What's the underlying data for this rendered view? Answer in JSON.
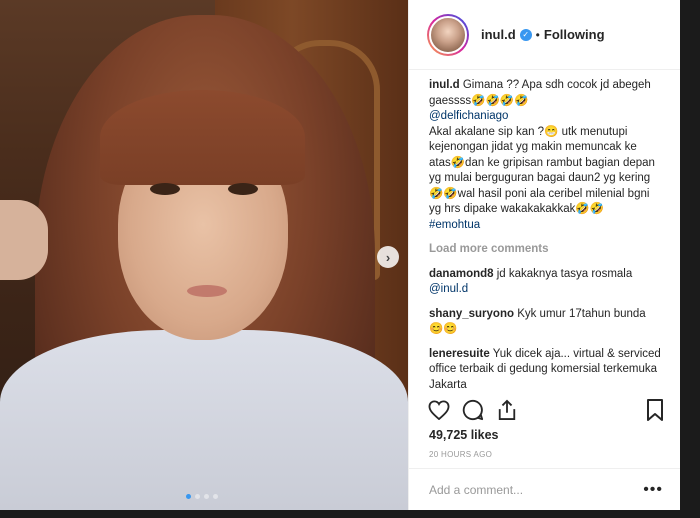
{
  "post": {
    "username": "inul.d",
    "separator": "•",
    "follow_status": "Following",
    "caption_username": "inul.d",
    "caption_line1": " Gimana ?? Apa sdh cocok jd abegeh gaessss🤣🤣🤣🤣",
    "mention": "@delfichaniago",
    "caption_body": "Akal akalane sip kan ?😁 utk menutupi kejenongan jidat yg makin memuncak ke atas🤣dan ke gripisan rambut bagian depan yg mulai berguguran bagai daun2 yg kering🤣🤣wal hasil poni ala ceribel milenial bgni yg hrs dipake wakakakakkak🤣🤣",
    "hashtag": "#emohtua",
    "load_more": "Load more comments",
    "comments": [
      {
        "user": "danamond8",
        "text": " jd kakaknya tasya rosmala ",
        "mention": "@inul.d"
      },
      {
        "user": "shany_suryono",
        "text": " Kyk umur 17tahun bunda 😊😊"
      },
      {
        "user": "leneresuite",
        "text": " Yuk dicek aja... virtual & serviced office terbaik di gedung komersial terkemuka Jakarta"
      }
    ],
    "likes": "49,725 likes",
    "time": "20 HOURS AGO",
    "add_comment_placeholder": "Add a comment...",
    "more_glyph": "•••"
  },
  "carousel": {
    "next_glyph": "›",
    "dots": 4,
    "active_dot": 0
  },
  "colors": {
    "link": "#003569",
    "verified": "#3897f0",
    "text": "#262626",
    "muted": "#999999"
  }
}
